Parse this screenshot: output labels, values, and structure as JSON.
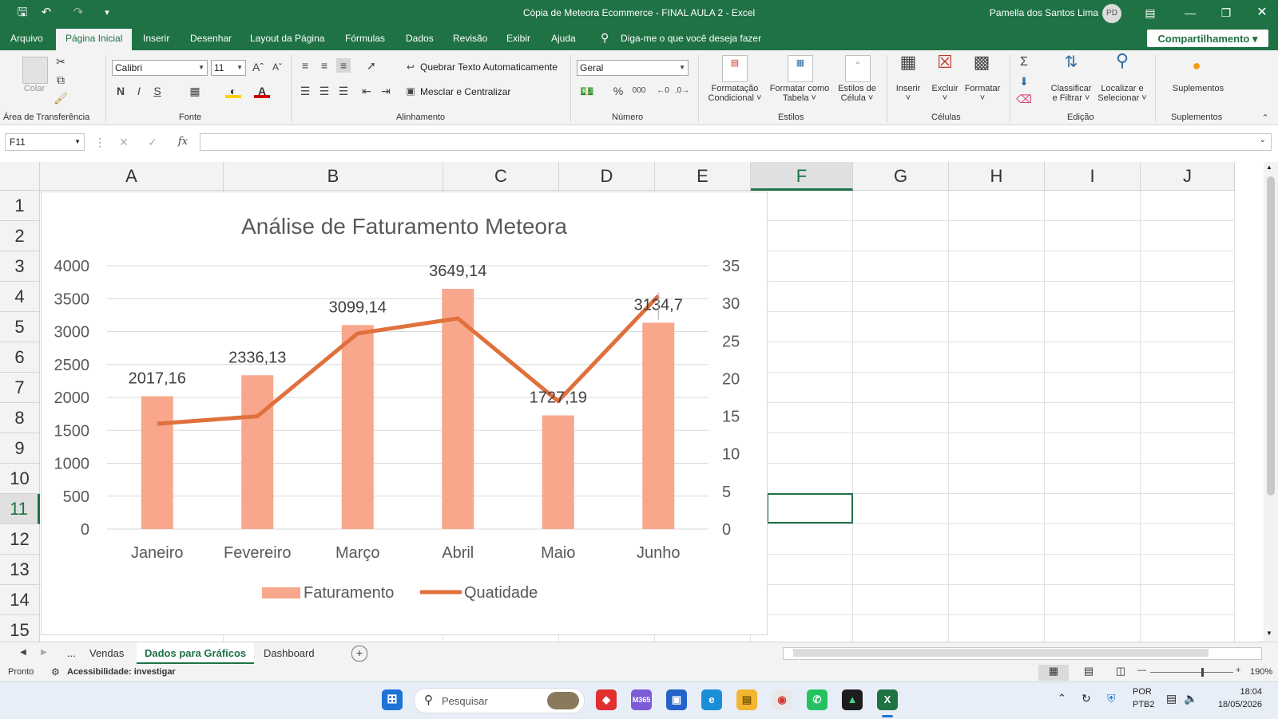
{
  "titlebar": {
    "doc_title": "Cópia de Meteora Ecommerce - FINAL AULA 2  -  Excel",
    "user_name": "Pamella dos Santos Lima",
    "avatar_initials": "PD"
  },
  "tabs": [
    "Arquivo",
    "Página Inicial",
    "Inserir",
    "Desenhar",
    "Layout da Página",
    "Fórmulas",
    "Dados",
    "Revisão",
    "Exibir",
    "Ajuda"
  ],
  "active_tab": "Página Inicial",
  "tell_me": "Diga-me o que você deseja fazer",
  "share_label": "Compartilhamento",
  "ribbon": {
    "clipboard": {
      "paste": "Colar",
      "label": "Área de Transferência"
    },
    "font": {
      "name": "Calibri",
      "size": "11",
      "bold": "N",
      "italic": "I",
      "underline": "S",
      "label": "Fonte"
    },
    "alignment": {
      "wrap": "Quebrar Texto Automaticamente",
      "merge": "Mesclar e Centralizar",
      "label": "Alinhamento"
    },
    "number": {
      "format": "Geral",
      "percent": "%",
      "thousands": "000",
      "label": "Número"
    },
    "styles": {
      "conditional": [
        "Formatação",
        "Condicional"
      ],
      "table": [
        "Formatar como",
        "Tabela"
      ],
      "cell": [
        "Estilos de",
        "Célula"
      ],
      "label": "Estilos"
    },
    "cells": {
      "insert": "Inserir",
      "delete": "Excluir",
      "format": "Formatar",
      "label": "Células"
    },
    "editing": {
      "sort": [
        "Classificar",
        "e Filtrar"
      ],
      "find": [
        "Localizar e",
        "Selecionar"
      ],
      "label": "Edição"
    },
    "addins": {
      "button": "Suplementos",
      "label": "Suplementos"
    }
  },
  "formula_bar": {
    "name_box": "F11",
    "fx": "fx",
    "formula": ""
  },
  "grid": {
    "columns": [
      "A",
      "B",
      "C",
      "D",
      "E",
      "F",
      "G",
      "H",
      "I",
      "J"
    ],
    "rows": [
      "1",
      "2",
      "3",
      "4",
      "5",
      "6",
      "7",
      "8",
      "9",
      "10",
      "11",
      "12",
      "13",
      "14",
      "15"
    ],
    "selected_column": "F",
    "selected_row": "11"
  },
  "chart_data": {
    "type": "bar",
    "title": "Análise de Faturamento Meteora",
    "categories": [
      "Janeiro",
      "Fevereiro",
      "Março",
      "Abril",
      "Maio",
      "Junho"
    ],
    "series": [
      {
        "name": "Faturamento",
        "type": "bar",
        "axis": "left",
        "values": [
          2017.16,
          2336.13,
          3099.14,
          3649.14,
          1727.19,
          3134.7
        ],
        "labels": [
          "2017,16",
          "2336,13",
          "3099,14",
          "3649,14",
          "1727,19",
          "3134,7"
        ],
        "color": "#f8a78c"
      },
      {
        "name": "Quatidade",
        "type": "line",
        "axis": "right",
        "values": [
          14,
          15,
          26,
          28,
          17,
          31
        ],
        "color": "#e0703c"
      }
    ],
    "y_left": {
      "min": 0,
      "max": 4000,
      "ticks": [
        "0",
        "500",
        "1000",
        "1500",
        "2000",
        "2500",
        "3000",
        "3500",
        "4000"
      ]
    },
    "y_right": {
      "min": 0,
      "max": 35,
      "ticks": [
        "0",
        "5",
        "10",
        "15",
        "20",
        "25",
        "30",
        "35"
      ]
    },
    "grid": true,
    "legend": "bottom"
  },
  "sheets": {
    "more": "...",
    "tabs": [
      "Vendas",
      "Dados para Gráficos",
      "Dashboard"
    ],
    "active": "Dados para Gráficos"
  },
  "status": {
    "ready": "Pronto",
    "accessibility": "Acessibilidade: investigar",
    "zoom": "190%"
  },
  "taskbar": {
    "search": "Pesquisar",
    "lang": "POR",
    "layout": "PTB2",
    "time": "18:04",
    "date": "18/05/2026"
  }
}
